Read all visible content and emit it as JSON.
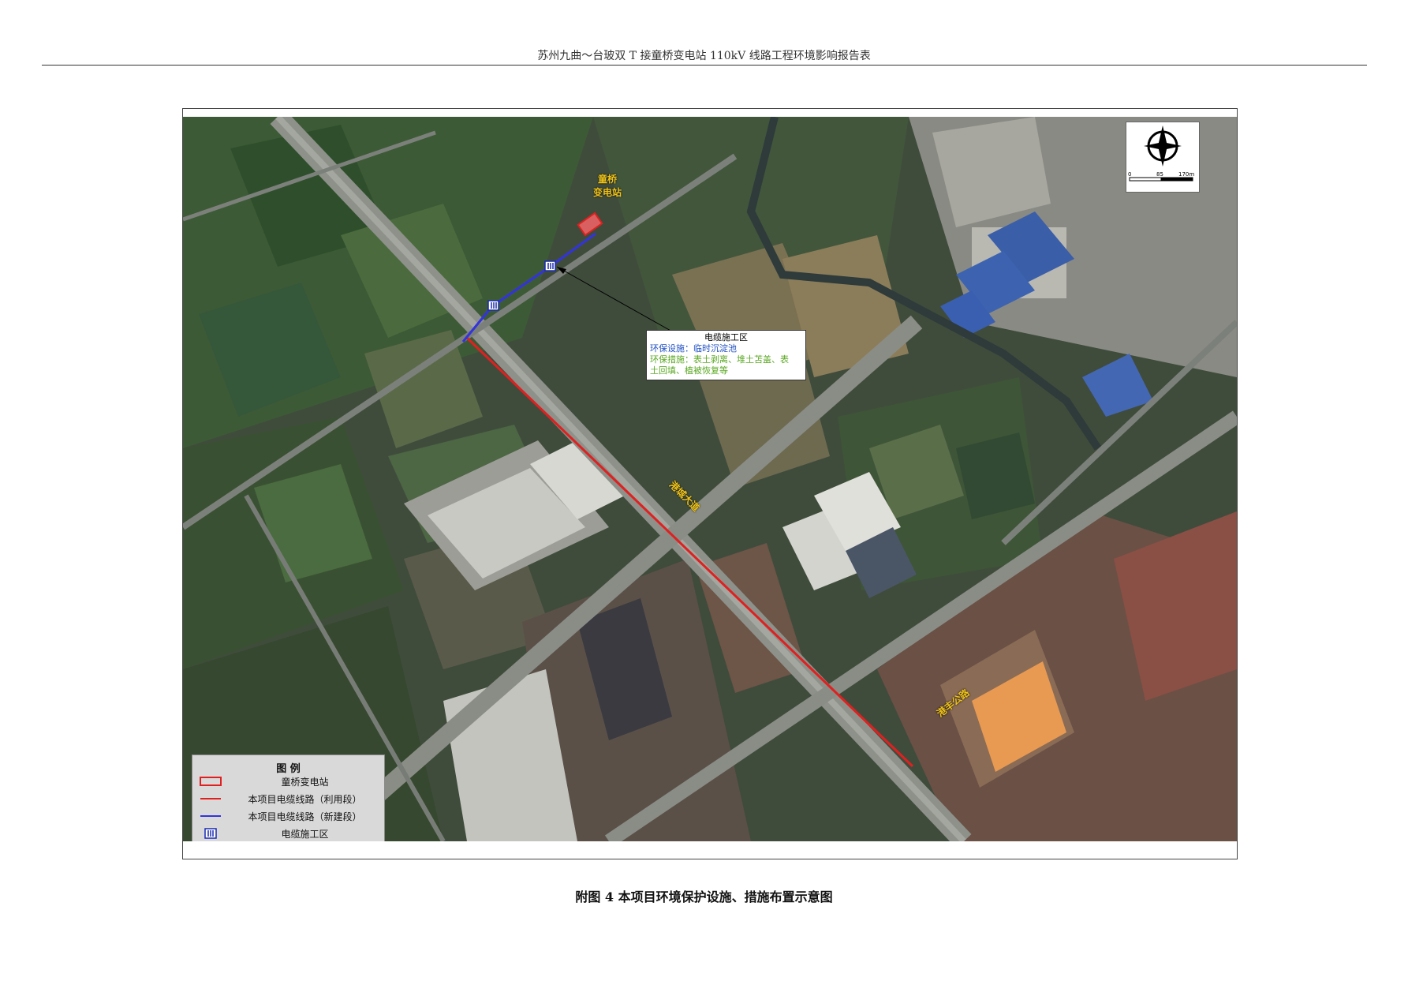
{
  "header": {
    "title": "苏州九曲～台玻双 T 接童桥变电站 110kV 线路工程环境影响报告表"
  },
  "map": {
    "substation_label_line1": "童桥",
    "substation_label_line2": "变电站",
    "road_label_1": "港城大道",
    "road_label_2": "港丰公路",
    "callout": {
      "title": "电缆施工区",
      "facilities": "环保设施：临时沉淀池",
      "measures_1": "环保措施：表土剥离、堆土苫盖、表",
      "measures_2": "土回填、植被恢复等"
    },
    "compass": {
      "north": "N",
      "scale_0": "0",
      "scale_mid": "85",
      "scale_end": "170m"
    },
    "colors": {
      "reuse_line": "#e02020",
      "new_line": "#3333dd",
      "substation": "#e02020",
      "construction": "#1a2bb0"
    }
  },
  "legend": {
    "title": "图 例",
    "items": [
      {
        "label": "童桥变电站",
        "symbol": "substation-box-icon"
      },
      {
        "label": "本项目电缆线路（利用段）",
        "symbol": "red-line-icon"
      },
      {
        "label": "本项目电缆线路（新建段）",
        "symbol": "blue-line-icon"
      },
      {
        "label": "电缆施工区",
        "symbol": "construction-zone-icon"
      }
    ]
  },
  "caption": "附图 4  本项目环境保护设施、措施布置示意图"
}
